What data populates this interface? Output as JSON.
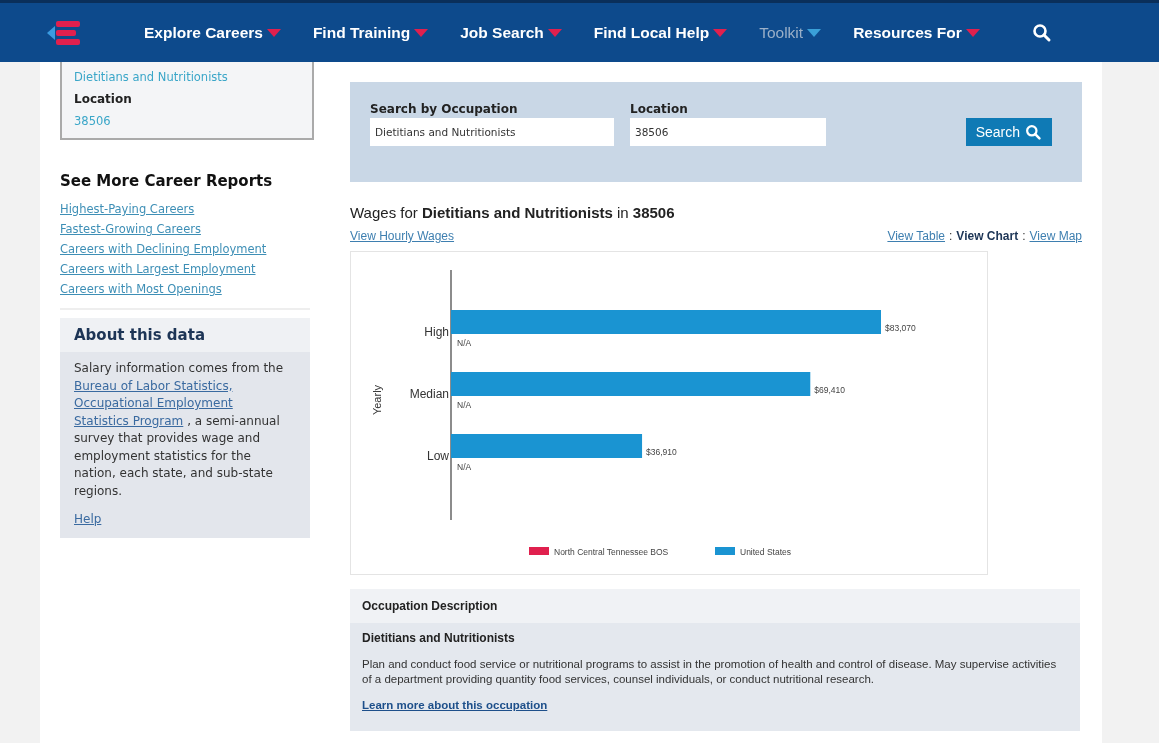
{
  "nav": {
    "items": [
      {
        "label": "Explore Careers",
        "selected": false
      },
      {
        "label": "Find Training",
        "selected": false
      },
      {
        "label": "Job Search",
        "selected": false
      },
      {
        "label": "Find Local Help",
        "selected": false
      },
      {
        "label": "Toolkit",
        "selected": true
      },
      {
        "label": "Resources For",
        "selected": false
      }
    ]
  },
  "summary_box": {
    "occupation": "Dietitians and Nutritionists",
    "location_label": "Location",
    "location": "38506"
  },
  "more_reports": {
    "title": "See More Career Reports",
    "links": [
      "Highest-Paying Careers",
      "Fastest-Growing Careers",
      "Careers with Declining Employment",
      "Careers with Largest Employment",
      "Careers with Most Openings"
    ]
  },
  "about": {
    "title": "About this data",
    "segments": [
      {
        "kind": "text",
        "text": "Salary information comes from the "
      },
      {
        "kind": "link",
        "text": "Bureau of Labor Statistics,"
      },
      {
        "kind": "link",
        "text": "Occupational Employment"
      },
      {
        "kind": "link",
        "text": "Statistics Program"
      },
      {
        "kind": "text",
        "text": ", a semi-annual survey that provides wage and employment statistics for the nation, each state, and sub-state regions."
      }
    ],
    "help": "Help"
  },
  "search": {
    "occupation_label": "Search by Occupation",
    "occupation_value": "Dietitians and Nutritionists",
    "location_label": "Location",
    "location_value": "38506",
    "button": "Search"
  },
  "wages": {
    "title": "Wages for **Dietitians and Nutritionists** in **38506**",
    "hourly_link": "View Hourly Wages",
    "separator": ":",
    "views": [
      {
        "label": "View Table",
        "selected": false
      },
      {
        "label": "View Chart",
        "selected": true
      },
      {
        "label": "View Map",
        "selected": false
      }
    ],
    "chart_data": {
      "type": "bar",
      "orientation": "horizontal",
      "ylabel": "Yearly",
      "categories": [
        "High",
        "Median",
        "Low"
      ],
      "series": [
        {
          "name": "North Central Tennessee BOS",
          "color": "#e0204e",
          "values": [
            null,
            null,
            null
          ],
          "value_labels": [
            "N/A",
            "N/A",
            "N/A"
          ]
        },
        {
          "name": "United States",
          "color": "#1a94d2",
          "values": [
            83070,
            69410,
            36910
          ],
          "value_labels": [
            "$83,070",
            "$69,410",
            "$36,910"
          ]
        }
      ]
    }
  },
  "description": {
    "header": "Occupation Description",
    "title": "Dietitians and Nutritionists",
    "text": "Plan and conduct food service or nutritional programs to assist in the promotion of health and control of disease. May supervise activities of a department providing quantity food services, counsel individuals, or conduct nutritional research.",
    "link": "Learn more about this occupation"
  }
}
